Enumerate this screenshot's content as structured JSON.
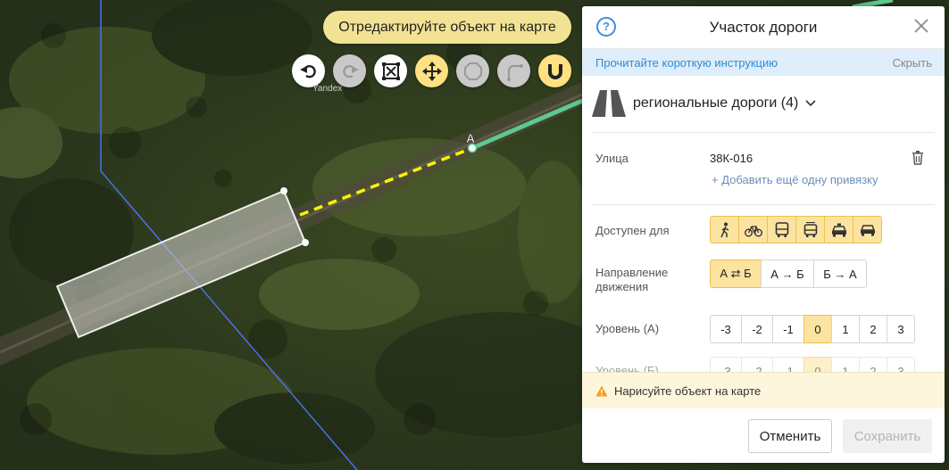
{
  "map": {
    "watermark": "Yandex",
    "point_label": "A",
    "hint": "Отредактируйте объект на карте"
  },
  "toolbar": [
    {
      "name": "undo-button",
      "icon": "undo-icon",
      "state": "active"
    },
    {
      "name": "redo-button",
      "icon": "redo-icon",
      "state": "disabled"
    },
    {
      "name": "select-area-button",
      "icon": "select-area-icon",
      "state": "active"
    },
    {
      "name": "move-button",
      "icon": "move-icon",
      "state": "selected"
    },
    {
      "name": "polygon-button",
      "icon": "polygon-icon",
      "state": "disabled"
    },
    {
      "name": "snap-angle-button",
      "icon": "angle-icon",
      "state": "disabled"
    },
    {
      "name": "magnet-button",
      "icon": "magnet-icon",
      "state": "selected"
    }
  ],
  "panel": {
    "title": "Участок дороги",
    "instruction_link": "Прочитайте короткую инструкцию",
    "instruction_hide": "Скрыть",
    "road_type": "региональные дороги (4)",
    "street_label": "Улица",
    "street_value": "38К-016",
    "add_binding": "+ Добавить ещё одну привязку",
    "access_label": "Доступен для",
    "access_icons": [
      "pedestrian-icon",
      "bicycle-icon",
      "bus-icon",
      "trolleybus-icon",
      "taxi-icon",
      "car-icon"
    ],
    "direction_label": "Направление движения",
    "direction_options": [
      "А ⇄ Б",
      "А → Б",
      "Б → А"
    ],
    "direction_selected": 0,
    "level_a_label": "Уровень (А)",
    "level_b_label": "Уровень (Б)",
    "level_options": [
      "-3",
      "-2",
      "-1",
      "0",
      "1",
      "2",
      "3"
    ],
    "level_a_selected": 3,
    "level_b_selected": 3,
    "warning": "Нарисуйте объект на карте",
    "cancel": "Отменить",
    "save": "Сохранить"
  },
  "colors": {
    "accent_yellow": "#ffe182",
    "link_blue": "#2e8ad8",
    "road_green": "#5ec98f",
    "dash_yellow": "#fff200",
    "boundary_blue": "#4a72e8"
  }
}
